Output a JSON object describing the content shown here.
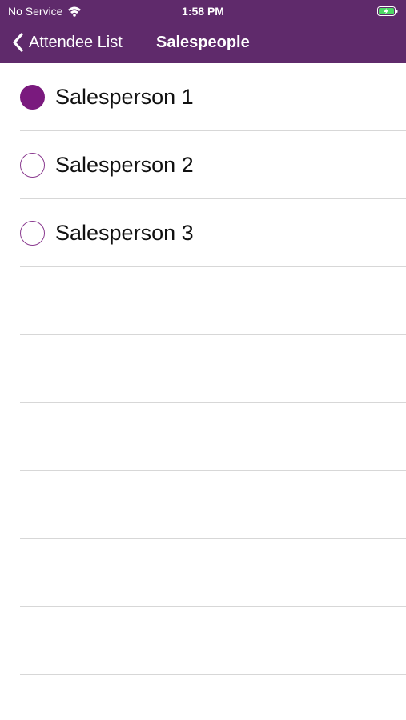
{
  "status_bar": {
    "carrier": "No Service",
    "time": "1:58 PM",
    "wifi_icon": "wifi-icon",
    "battery_icon": "battery-charging-icon"
  },
  "nav_bar": {
    "back_label": "Attendee List",
    "title": "Salespeople",
    "back_icon": "chevron-left-icon"
  },
  "colors": {
    "header_background": "#5f2a6b",
    "accent": "#7a1a7e",
    "separator": "#d7d7d7"
  },
  "salespeople": [
    {
      "label": "Salesperson 1",
      "selected": true
    },
    {
      "label": "Salesperson 2",
      "selected": false
    },
    {
      "label": "Salesperson 3",
      "selected": false
    }
  ],
  "empty_rows": 6
}
